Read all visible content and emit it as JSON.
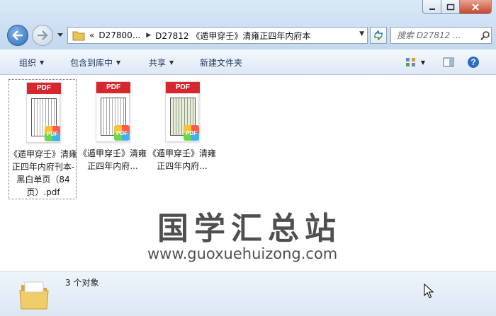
{
  "window": {
    "accent": "#cfe1f3",
    "close_color": "#c9462c"
  },
  "nav": {
    "breadcrumb_overflow": "«",
    "breadcrumb": [
      "D27800...",
      "D27812 《遁甲穿壬》清雍正四年内府本"
    ],
    "search_placeholder": "搜索 D27812 ..."
  },
  "toolbar": {
    "items": [
      {
        "label": "组织",
        "has_menu": true
      },
      {
        "label": "包含到库中",
        "has_menu": true
      },
      {
        "label": "共享",
        "has_menu": true
      },
      {
        "label": "新建文件夹",
        "has_menu": false
      }
    ]
  },
  "files": [
    {
      "name": "《遁甲穿壬》清雍正四年内府刊本-黑白单页（84页）.pdf",
      "type_label": "PDF",
      "badge": "PDF",
      "selected": true,
      "page_tint": "white"
    },
    {
      "name": "《遁甲穿壬》清雍正四年内府...",
      "type_label": "PDF",
      "badge": "PDF",
      "selected": false,
      "page_tint": "white"
    },
    {
      "name": "《遁甲穿壬》清雍正四年内府...",
      "type_label": "PDF",
      "badge": "PDF",
      "selected": false,
      "page_tint": "green"
    }
  ],
  "watermark": {
    "text": "国学汇总站",
    "url": "www.guoxuehuizong.com"
  },
  "status": {
    "count_text": "3 个对象"
  }
}
